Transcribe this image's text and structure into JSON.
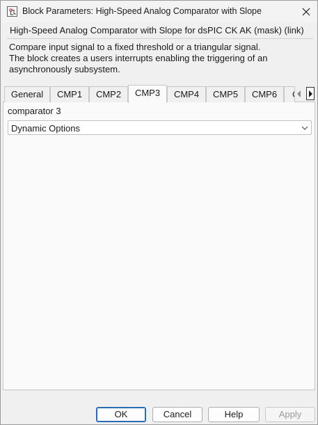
{
  "window": {
    "title": "Block Parameters: High-Speed Analog Comparator with Slope"
  },
  "description": {
    "header": "High-Speed Analog Comparator with Slope for dsPIC CK  AK (mask) (link)",
    "lines": [
      "Compare input signal to a fixed threshold or a triangular signal.",
      "The block creates a users interrupts enabling the triggering of an",
      "asynchronously subsystem."
    ]
  },
  "tabs": [
    {
      "label": "General",
      "active": false
    },
    {
      "label": "CMP1",
      "active": false
    },
    {
      "label": "CMP2",
      "active": false
    },
    {
      "label": "CMP3",
      "active": true
    },
    {
      "label": "CMP4",
      "active": false
    },
    {
      "label": "CMP5",
      "active": false
    },
    {
      "label": "CMP6",
      "active": false
    },
    {
      "label": "C",
      "active": false
    }
  ],
  "panel": {
    "group_label": "comparator 3",
    "dropdown_value": "Dynamic Options"
  },
  "buttons": {
    "ok": "OK",
    "cancel": "Cancel",
    "help": "Help",
    "apply": "Apply"
  },
  "colors": {
    "default_button_border": "#2a6bb8",
    "disabled_text": "#9a9a9a"
  }
}
